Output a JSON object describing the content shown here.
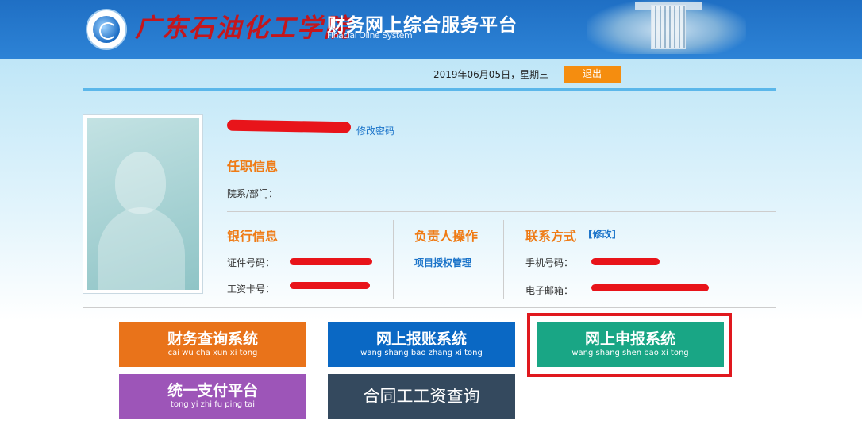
{
  "header": {
    "school_name": "广东石油化工学院",
    "platform_title": "财务网上综合服务平台",
    "platform_subtitle": "Finacial Oline System"
  },
  "topbar": {
    "date": "2019年06月05日，星期三",
    "logout_label": "退出"
  },
  "profile": {
    "change_password": "修改密码",
    "job_info_title": "任职信息",
    "department_label": "院系/部门："
  },
  "bank": {
    "title": "银行信息",
    "id_label": "证件号码：",
    "salary_card_label": "工资卡号："
  },
  "owner": {
    "title": "负责人操作",
    "project_auth": "项目授权管理"
  },
  "contact": {
    "title": "联系方式",
    "edit_label": "[修改]",
    "phone_label": "手机号码：",
    "email_label": "电子邮箱："
  },
  "tiles": [
    {
      "title": "财务查询系统",
      "subtitle": "cai wu cha xun xi tong",
      "color": "#e9731a"
    },
    {
      "title": "网上报账系统",
      "subtitle": "wang shang bao zhang xi tong",
      "color": "#0a68c4"
    },
    {
      "title": "网上申报系统",
      "subtitle": "wang shang shen bao xi tong",
      "color": "#19a685"
    },
    {
      "title": "统一支付平台",
      "subtitle": "tong yi zhi fu ping tai",
      "color": "#9d55b8"
    },
    {
      "title": "合同工工资查询",
      "subtitle": "",
      "color": "#34495e"
    }
  ],
  "colors": {
    "header_blue": "#1f6fc4",
    "accent_orange": "#ef7b15",
    "link_blue": "#1a73c9",
    "highlight_red": "#e0181e"
  }
}
